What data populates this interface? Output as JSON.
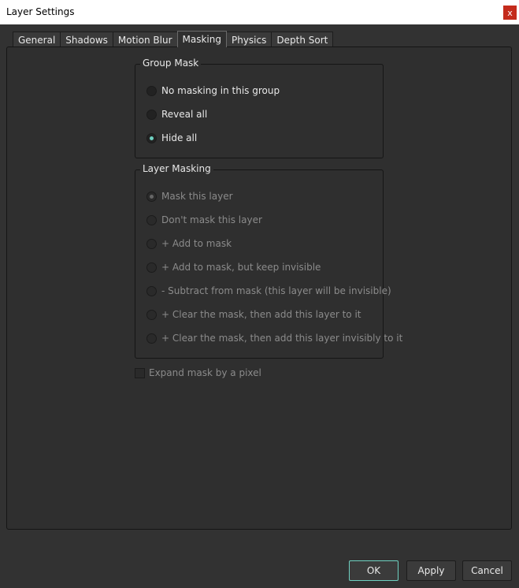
{
  "window": {
    "title": "Layer Settings",
    "close_label": "x"
  },
  "tabs": [
    {
      "label": "General",
      "active": false
    },
    {
      "label": "Shadows",
      "active": false
    },
    {
      "label": "Motion Blur",
      "active": false
    },
    {
      "label": "Masking",
      "active": true
    },
    {
      "label": "Physics",
      "active": false
    },
    {
      "label": "Depth Sort",
      "active": false
    }
  ],
  "group_mask": {
    "title": "Group Mask",
    "options": [
      {
        "label": "No masking in this group",
        "checked": false
      },
      {
        "label": "Reveal all",
        "checked": false
      },
      {
        "label": "Hide all",
        "checked": true
      }
    ]
  },
  "layer_masking": {
    "title": "Layer Masking",
    "enabled": false,
    "options": [
      {
        "label": "Mask this layer",
        "checked": true
      },
      {
        "label": "Don't mask this layer",
        "checked": false
      },
      {
        "label": "+ Add to mask",
        "checked": false
      },
      {
        "label": "+ Add to mask, but keep invisible",
        "checked": false
      },
      {
        "label": "- Subtract from mask (this layer will be invisible)",
        "checked": false
      },
      {
        "label": "+ Clear the mask, then add this layer to it",
        "checked": false
      },
      {
        "label": "+ Clear the mask, then add this layer invisibly to it",
        "checked": false
      }
    ]
  },
  "expand_mask": {
    "label": "Expand mask by a pixel",
    "checked": false,
    "enabled": false
  },
  "buttons": {
    "ok": "OK",
    "apply": "Apply",
    "cancel": "Cancel"
  },
  "colors": {
    "accent": "#6fd1c1",
    "background": "#323232",
    "close": "#c42b1c"
  }
}
